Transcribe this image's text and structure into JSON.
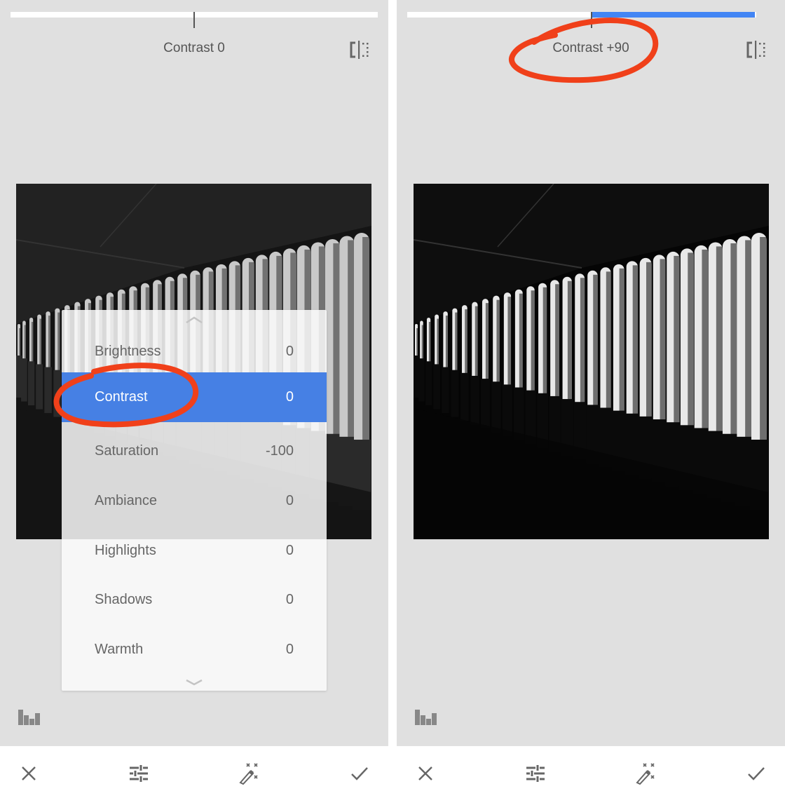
{
  "colors": {
    "accent": "#4285f4",
    "selected_row": "#4680e4",
    "annotation": "#f0401a",
    "background": "#e0e0e0",
    "icon": "#666666"
  },
  "left_pane": {
    "adjustment_label": "Contrast 0",
    "slider_value": 0,
    "slider_range": [
      -100,
      100
    ],
    "compare_icon": "compare-split-icon",
    "histogram_icon": "histogram-icon",
    "menu": {
      "scroll_up_icon": "chevron-up-icon",
      "scroll_down_icon": "chevron-down-icon",
      "items": [
        {
          "label": "Brightness",
          "value": "0",
          "selected": false
        },
        {
          "label": "Contrast",
          "value": "0",
          "selected": true
        },
        {
          "label": "Saturation",
          "value": "-100",
          "selected": false
        },
        {
          "label": "Ambiance",
          "value": "0",
          "selected": false
        },
        {
          "label": "Highlights",
          "value": "0",
          "selected": false
        },
        {
          "label": "Shadows",
          "value": "0",
          "selected": false
        },
        {
          "label": "Warmth",
          "value": "0",
          "selected": false
        }
      ]
    },
    "bottom_bar": {
      "cancel_icon": "close-icon",
      "adjust_icon": "sliders-icon",
      "auto_icon": "magic-wand-icon",
      "apply_icon": "checkmark-icon"
    }
  },
  "right_pane": {
    "adjustment_label": "Contrast +90",
    "slider_value": 90,
    "slider_range": [
      -100,
      100
    ],
    "compare_icon": "compare-split-icon",
    "histogram_icon": "histogram-icon",
    "bottom_bar": {
      "cancel_icon": "close-icon",
      "adjust_icon": "sliders-icon",
      "auto_icon": "magic-wand-icon",
      "apply_icon": "checkmark-icon"
    }
  },
  "photo": {
    "description": "Black and white photo of a covered walkway with a row of concrete pillars"
  }
}
